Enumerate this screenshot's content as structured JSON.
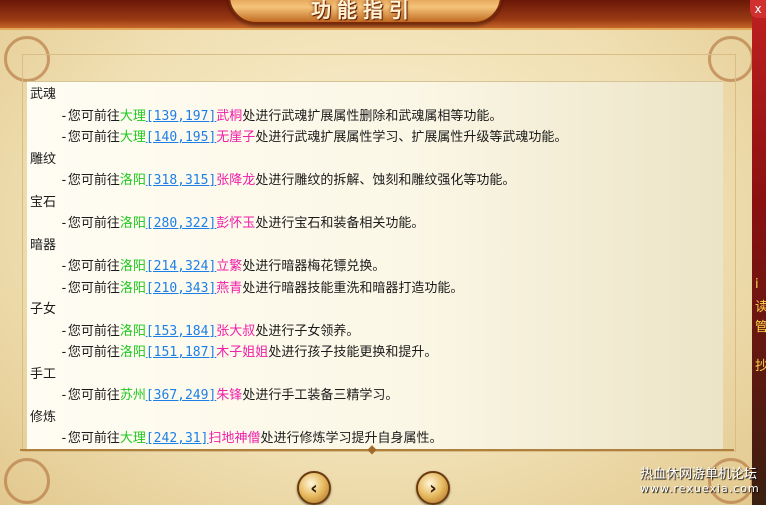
{
  "window": {
    "title": "功能指引"
  },
  "sections": [
    {
      "category": "武魂",
      "entries": [
        {
          "prefix": "-您可前往",
          "city": "大理",
          "coord": "[139,197]",
          "npc": "武桐",
          "desc": "处进行武魂扩展属性删除和武魂属相等功能。"
        },
        {
          "prefix": "-您可前往",
          "city": "大理",
          "coord": "[140,195]",
          "npc": "无崖子",
          "desc": "处进行武魂扩展属性学习、扩展属性升级等武魂功能。"
        }
      ]
    },
    {
      "category": "雕纹",
      "entries": [
        {
          "prefix": "-您可前往",
          "city": "洛阳",
          "coord": "[318,315]",
          "npc": "张降龙",
          "desc": "处进行雕纹的拆解、蚀刻和雕纹强化等功能。"
        }
      ]
    },
    {
      "category": "宝石",
      "entries": [
        {
          "prefix": "-您可前往",
          "city": "洛阳",
          "coord": "[280,322]",
          "npc": "彭怀玉",
          "desc": "处进行宝石和装备相关功能。"
        }
      ]
    },
    {
      "category": "暗器",
      "entries": [
        {
          "prefix": "-您可前往",
          "city": "洛阳",
          "coord": "[214,324]",
          "npc": "立繁",
          "desc": "处进行暗器梅花镖兑换。"
        },
        {
          "prefix": "-您可前往",
          "city": "洛阳",
          "coord": "[210,343]",
          "npc": "燕青",
          "desc": "处进行暗器技能重洗和暗器打造功能。"
        }
      ]
    },
    {
      "category": "子女",
      "entries": [
        {
          "prefix": "-您可前往",
          "city": "洛阳",
          "coord": "[153,184]",
          "npc": "张大叔",
          "desc": "处进行子女领养。"
        },
        {
          "prefix": "-您可前往",
          "city": "洛阳",
          "coord": "[151,187]",
          "npc": "木子姐姐",
          "desc": "处进行孩子技能更换和提升。"
        }
      ]
    },
    {
      "category": "手工",
      "entries": [
        {
          "prefix": "-您可前往",
          "city": "苏州",
          "coord": "[367,249]",
          "npc": "朱锋",
          "desc": "处进行手工装备三精学习。"
        }
      ]
    },
    {
      "category": "修炼",
      "entries": [
        {
          "prefix": "-您可前往",
          "city": "大理",
          "coord": "[242,31]",
          "npc": "扫地神僧",
          "desc": "处进行修炼学习提升自身属性。"
        }
      ]
    }
  ],
  "navigation": {
    "prev_icon": "arrow-left-icon",
    "next_icon": "arrow-right-icon",
    "prev_glyph": "‹",
    "next_glyph": "›"
  },
  "side": {
    "close_glyph": "x",
    "chars": [
      "i",
      "读",
      "管",
      "抄"
    ]
  },
  "watermark": {
    "line1": "热血休网游单机论坛",
    "line2": "www.rexuexia.com"
  },
  "colors": {
    "city": "#1fc81f",
    "coord": "#1d7fe6",
    "npc": "#f01ea8",
    "text": "#1a1a1a"
  }
}
